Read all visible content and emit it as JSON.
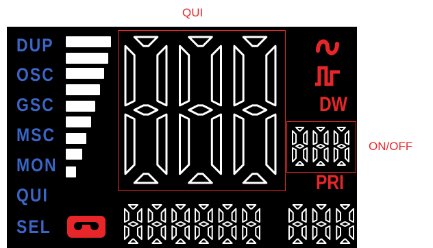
{
  "annotations": {
    "qui_label": "QUI",
    "onoff_label": "ON/OFF"
  },
  "modes": [
    {
      "key": "dup",
      "label": "DUP"
    },
    {
      "key": "osc",
      "label": "OSC"
    },
    {
      "key": "gsc",
      "label": "GSC"
    },
    {
      "key": "msc",
      "label": "MSC"
    },
    {
      "key": "mon",
      "label": "MON"
    },
    {
      "key": "qui",
      "label": "QUI"
    },
    {
      "key": "sel",
      "label": "SEL"
    }
  ],
  "level_bars": {
    "count": 9
  },
  "right_panel": {
    "dw_label": "DW",
    "pri_label": "PRI"
  },
  "digit_groups": {
    "main": {
      "text": "888"
    },
    "onoff": {
      "text": "888"
    },
    "bottom_left": {
      "text": "888"
    },
    "bottom_middle": {
      "text": "888"
    },
    "bottom_right": {
      "text": "888"
    }
  },
  "icons": [
    "sine-wave-icon",
    "square-wave-icon",
    "cassette-icon"
  ],
  "colors": {
    "lcd_background": "#000000",
    "segment": "#ffffff",
    "mode_label": "#3a66c8",
    "accent_red": "#e8262a"
  }
}
